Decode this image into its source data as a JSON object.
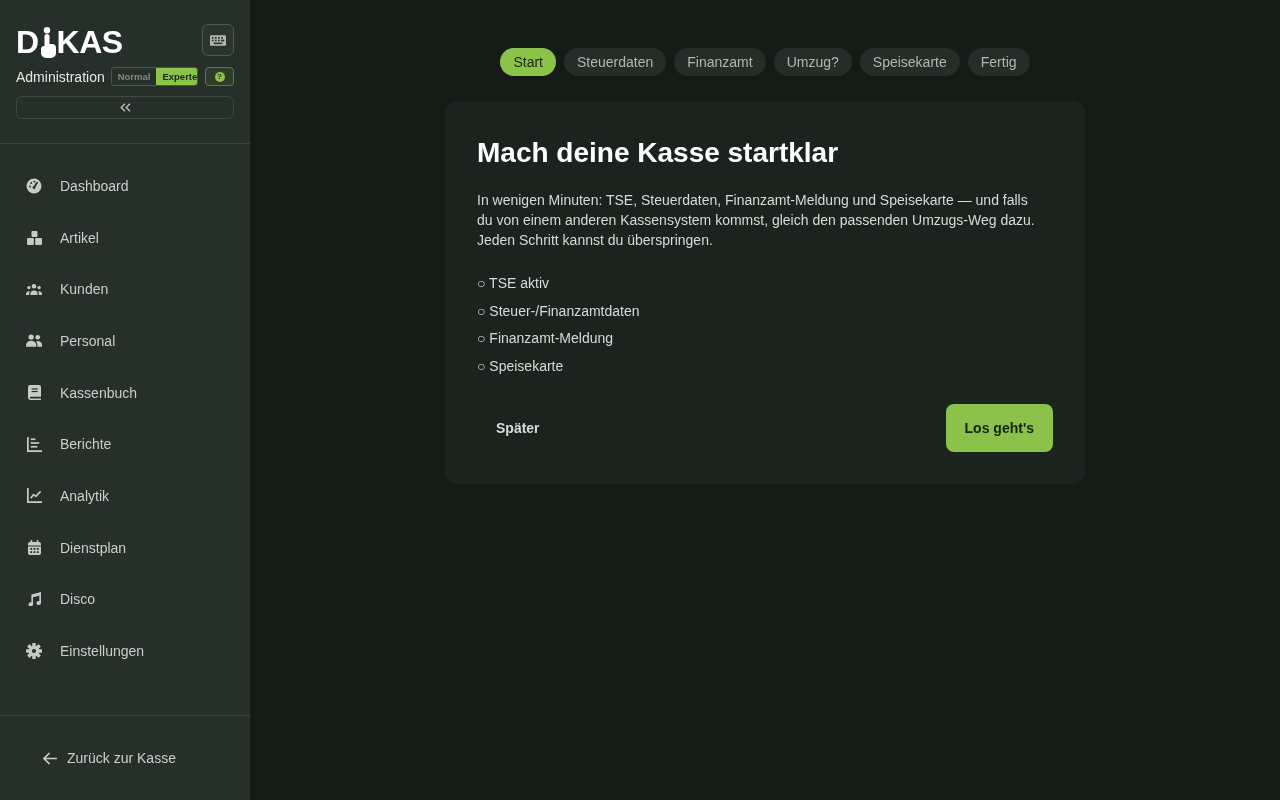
{
  "sidebar": {
    "logo": {
      "left": "D",
      "right": "KAS"
    },
    "section": "Administration",
    "mode_toggle": [
      {
        "label": "Normal",
        "selected": false
      },
      {
        "label": "Experte",
        "selected": true
      }
    ],
    "help_button": "?",
    "nav": [
      {
        "label": "Dashboard",
        "kind": "gauge"
      },
      {
        "label": "Artikel",
        "kind": "boxes"
      },
      {
        "label": "Kunden",
        "kind": "group"
      },
      {
        "label": "Personal",
        "kind": "pair"
      },
      {
        "label": "Kassenbuch",
        "kind": "book"
      },
      {
        "label": "Berichte",
        "kind": "bars"
      },
      {
        "label": "Analytik",
        "kind": "line"
      },
      {
        "label": "Dienstplan",
        "kind": "calendar"
      },
      {
        "label": "Disco",
        "kind": "music"
      },
      {
        "label": "Einstellungen",
        "kind": "gear"
      }
    ],
    "back_link": "Zurück zur Kasse"
  },
  "steps": [
    {
      "label": "Start",
      "selected": true
    },
    {
      "label": "Steuerdaten",
      "selected": false
    },
    {
      "label": "Finanzamt",
      "selected": false
    },
    {
      "label": "Umzug?",
      "selected": false
    },
    {
      "label": "Speisekarte",
      "selected": false
    },
    {
      "label": "Fertig",
      "selected": false
    }
  ],
  "card": {
    "title": "Mach deine Kasse startklar",
    "description": "In wenigen Minuten: TSE, Steuerdaten, Finanzamt-Meldung und Speisekarte — und falls du von einem anderen Kassensystem kommst, gleich den passenden Umzugs-Weg dazu. Jeden Schritt kannst du überspringen.",
    "checklist": [
      "○ TSE aktiv",
      "○ Steuer-/Finanzamtdaten",
      "○ Finanzamt-Meldung",
      "○ Speisekarte"
    ],
    "buttons": [
      {
        "label": "Später",
        "kind": "secondary"
      },
      {
        "label": "Los geht's",
        "kind": "primary"
      }
    ]
  }
}
